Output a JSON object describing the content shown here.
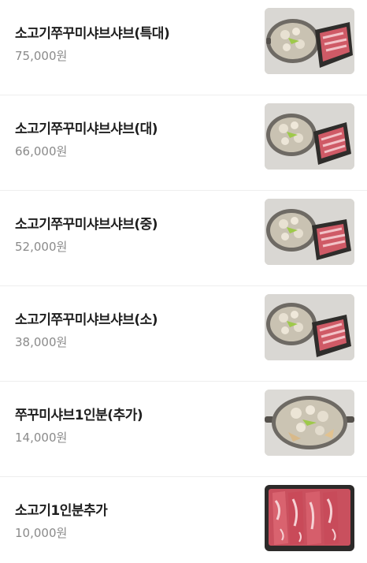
{
  "menu": {
    "items": [
      {
        "name": "소고기쭈꾸미샤브샤브(특대)",
        "price": "75,000원",
        "image": "beef-webfoot-octopus-shabu-photo"
      },
      {
        "name": "소고기쭈꾸미샤브샤브(대)",
        "price": "66,000원",
        "image": "beef-webfoot-octopus-shabu-photo"
      },
      {
        "name": "소고기쭈꾸미샤브샤브(중)",
        "price": "52,000원",
        "image": "beef-webfoot-octopus-shabu-photo"
      },
      {
        "name": "소고기쭈꾸미샤브샤브(소)",
        "price": "38,000원",
        "image": "beef-webfoot-octopus-shabu-photo"
      },
      {
        "name": "쭈꾸미샤브1인분(추가)",
        "price": "14,000원",
        "image": "webfoot-octopus-hotpot-photo"
      },
      {
        "name": "소고기1인분추가",
        "price": "10,000원",
        "image": "sliced-beef-tray-photo"
      }
    ]
  }
}
